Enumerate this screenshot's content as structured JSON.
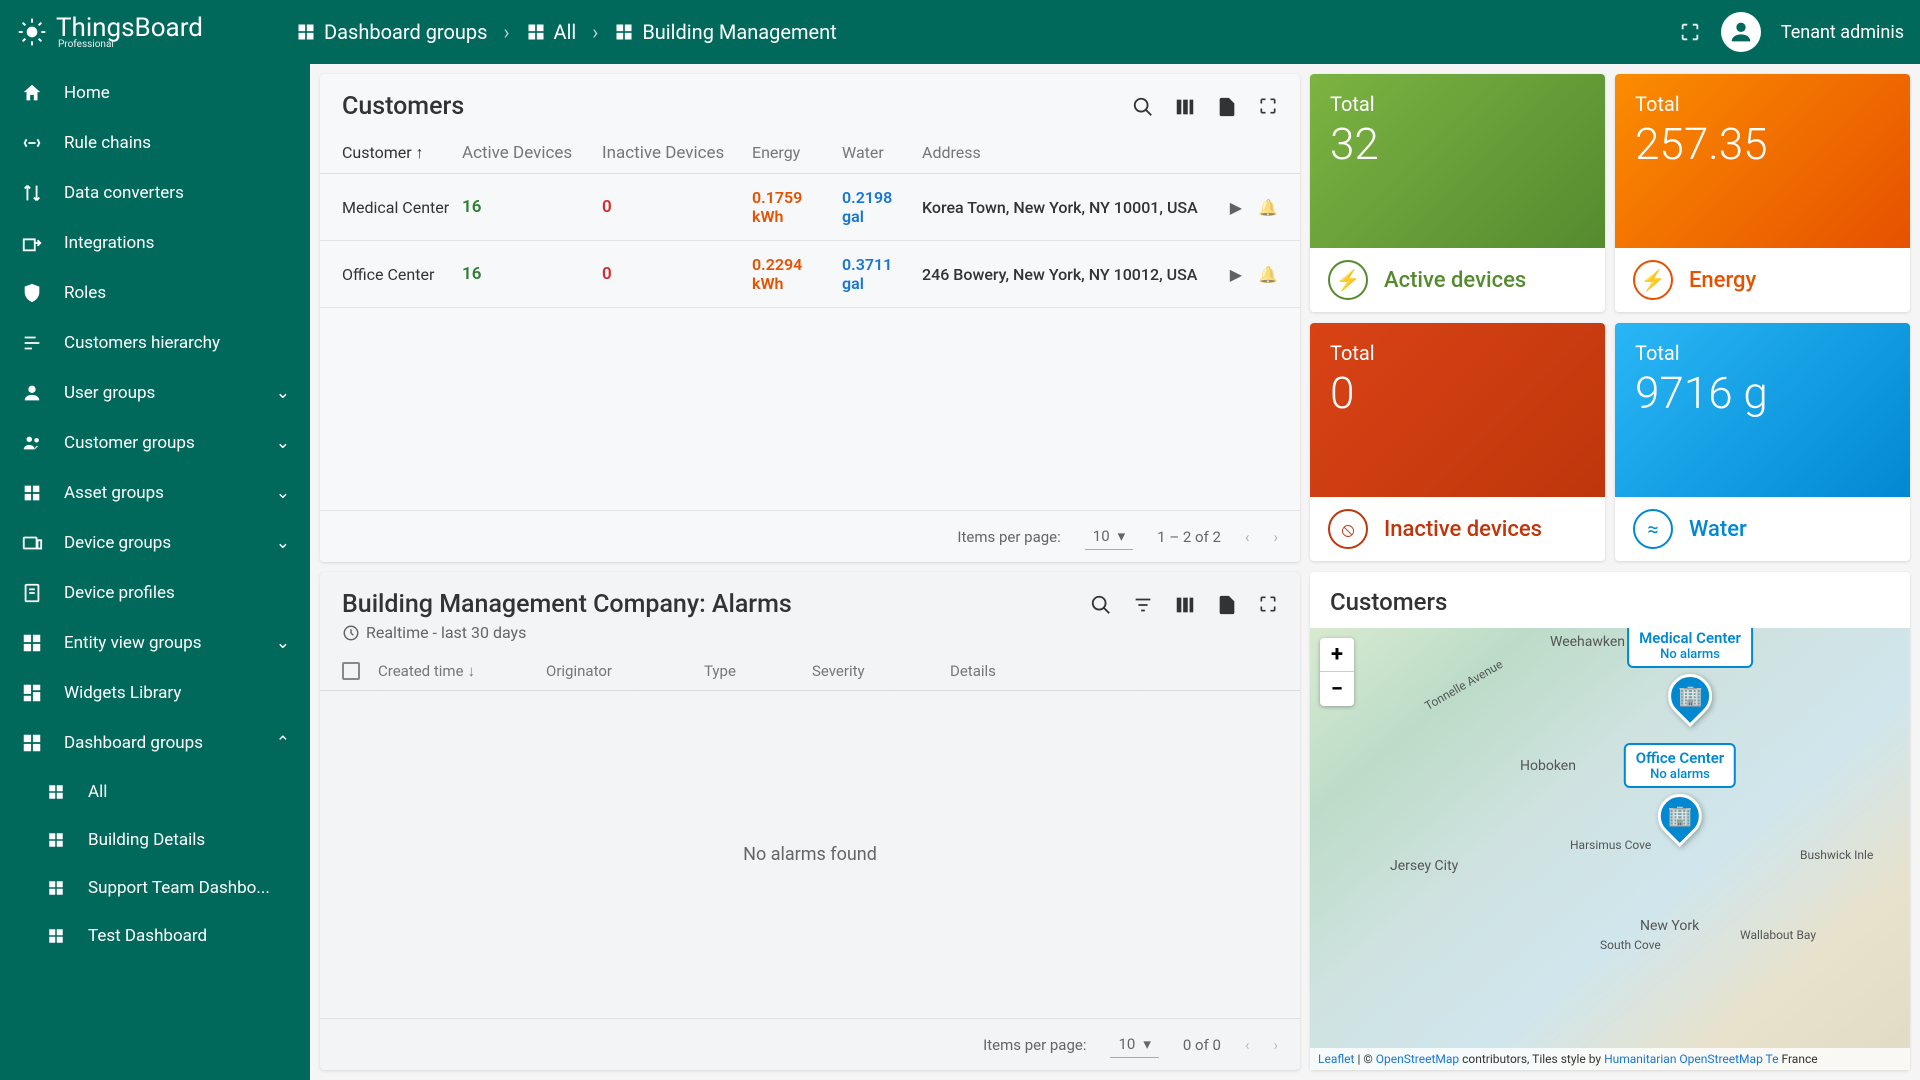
{
  "brand": {
    "name": "ThingsBoard",
    "edition": "Professional"
  },
  "breadcrumb": [
    {
      "label": "Dashboard groups"
    },
    {
      "label": "All"
    },
    {
      "label": "Building Management"
    }
  ],
  "user": {
    "label": "Tenant adminis"
  },
  "sidebar": [
    {
      "label": "Home",
      "icon": "home"
    },
    {
      "label": "Rule chains",
      "icon": "chain"
    },
    {
      "label": "Data converters",
      "icon": "convert"
    },
    {
      "label": "Integrations",
      "icon": "integration"
    },
    {
      "label": "Roles",
      "icon": "shield"
    },
    {
      "label": "Customers hierarchy",
      "icon": "list"
    },
    {
      "label": "User groups",
      "icon": "user",
      "expandable": true
    },
    {
      "label": "Customer groups",
      "icon": "people",
      "expandable": true
    },
    {
      "label": "Asset groups",
      "icon": "asset",
      "expandable": true
    },
    {
      "label": "Device groups",
      "icon": "device",
      "expandable": true
    },
    {
      "label": "Device profiles",
      "icon": "profile"
    },
    {
      "label": "Entity view groups",
      "icon": "entity",
      "expandable": true
    },
    {
      "label": "Widgets Library",
      "icon": "widget"
    },
    {
      "label": "Dashboard groups",
      "icon": "dashboard",
      "expandable": true,
      "expanded": true,
      "children": [
        {
          "label": "All"
        },
        {
          "label": "Building Details"
        },
        {
          "label": "Support Team Dashbo..."
        },
        {
          "label": "Test Dashboard"
        }
      ]
    }
  ],
  "customers_panel": {
    "title": "Customers",
    "columns": [
      "Customer",
      "Active Devices",
      "Inactive Devices",
      "Energy",
      "Water",
      "Address"
    ],
    "rows": [
      {
        "name": "Medical Center",
        "active": "16",
        "inactive": "0",
        "energy": "0.1759",
        "energy_unit": "kWh",
        "water": "0.2198",
        "water_unit": "gal",
        "address": "Korea Town, New York, NY 10001, USA"
      },
      {
        "name": "Office Center",
        "active": "16",
        "inactive": "0",
        "energy": "0.2294",
        "energy_unit": "kWh",
        "water": "0.3711",
        "water_unit": "gal",
        "address": "246 Bowery, New York, NY 10012, USA"
      }
    ],
    "pager": {
      "label": "Items per page:",
      "size": "10",
      "range": "1 – 2 of 2"
    }
  },
  "alarms_panel": {
    "title": "Building Management Company: Alarms",
    "subtitle": "Realtime - last 30 days",
    "columns": [
      "Created time",
      "Originator",
      "Type",
      "Severity",
      "Details"
    ],
    "empty": "No alarms found",
    "pager": {
      "label": "Items per page:",
      "size": "10",
      "range": "0 of 0"
    }
  },
  "cards": {
    "active": {
      "label": "Total",
      "value": "32",
      "name": "Active devices"
    },
    "energy": {
      "label": "Total",
      "value": "257.35",
      "name": "Energy"
    },
    "inactive": {
      "label": "Total",
      "value": "0",
      "name": "Inactive devices"
    },
    "water": {
      "label": "Total",
      "value": "9716 g",
      "name": "Water"
    }
  },
  "map": {
    "title": "Customers",
    "pins": [
      {
        "name": "Medical Center",
        "status": "No alarms"
      },
      {
        "name": "Office Center",
        "status": "No alarms"
      }
    ],
    "cities": [
      "Weehawken",
      "Hoboken",
      "Jersey City",
      "New York",
      "Harsimus Cove",
      "South Cove",
      "Wallabout Bay",
      "Bushwick Inle",
      "Tonnelle Avenue"
    ],
    "attrib": {
      "leaflet": "Leaflet",
      "osm": "OpenStreetMap",
      "mid": " contributors, Tiles style by ",
      "hot": "Humanitarian OpenStreetMap Te",
      "france": "France"
    }
  }
}
